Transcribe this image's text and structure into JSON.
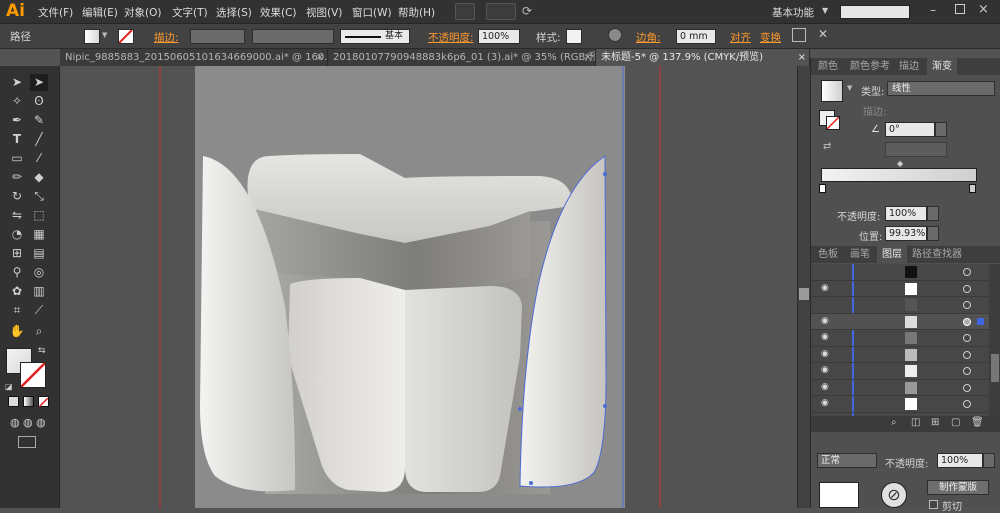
{
  "app": {
    "logo": "Ai"
  },
  "menu": {
    "items": [
      "文件(F)",
      "编辑(E)",
      "对象(O)",
      "文字(T)",
      "选择(S)",
      "效果(C)",
      "视图(V)",
      "窗口(W)",
      "帮助(H)"
    ],
    "workspace": "基本功能"
  },
  "control_bar": {
    "selection_type": "路径",
    "stroke_label": "描边:",
    "stroke_style": "基本",
    "opacity_label": "不透明度:",
    "opacity_value": "100%",
    "style_label": "样式:",
    "corner_label": "边角:",
    "corner_value": "0 mm",
    "align_label": "对齐",
    "transform_label": "变换"
  },
  "doc_tabs": [
    {
      "label": "Nipic_9885883_20150605101634669000.ai* @ 160.7...",
      "close": "×"
    },
    {
      "label": "20180107790948883k6p6_01 (3).ai* @ 35% (RGB/预...",
      "close": "×"
    },
    {
      "label": "未标题-5* @ 137.9% (CMYK/预览)",
      "close": "×"
    }
  ],
  "gradient_panel": {
    "tabs": [
      "颜色",
      "颜色参考",
      "描边",
      "渐变"
    ],
    "active_tab": "渐变",
    "type_label": "类型:",
    "type_value": "线性",
    "stroke_label": "描边:",
    "angle_value": "0°",
    "opacity_label": "不透明度:",
    "opacity_value": "100%",
    "location_label": "位置:",
    "location_value": "99.93%"
  },
  "layers_panel": {
    "tabs": [
      "色板",
      "画笔",
      "图层",
      "路径查找器"
    ],
    "active_tab": "图层",
    "rows": 9
  },
  "transparency_panel": {
    "blend_mode": "正常",
    "opacity_label": "不透明度:",
    "opacity_value": "100%",
    "make_mask_label": "制作蒙版",
    "clip_label": "剪切"
  },
  "colors": {
    "accent_orange": "#ff9a00",
    "guide_red": "#d03a3a",
    "selection_blue": "#4c6bd6",
    "artboard": "#8c8c8c"
  }
}
